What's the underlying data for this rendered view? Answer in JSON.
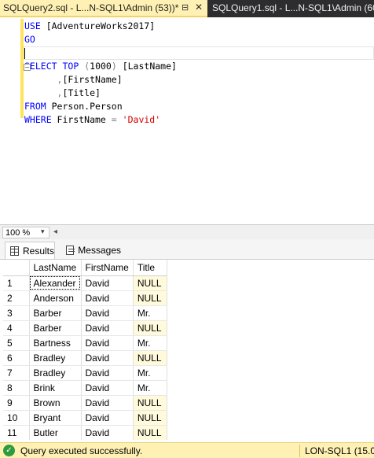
{
  "tabs": {
    "active": {
      "title": "SQLQuery2.sql - L...N-SQL1\\Admin (53))*",
      "pin": "⊟",
      "close": "✕"
    },
    "inactive": {
      "title": "SQLQuery1.sql - L...N-SQL1\\Admin (60"
    }
  },
  "editor": {
    "line1": {
      "kw": "USE",
      "rest": " [AdventureWorks2017]"
    },
    "line2": {
      "kw": "GO"
    },
    "line4": {
      "kw1": "SELECT",
      "sp1": " ",
      "kw2": "TOP",
      "sp2": " ",
      "paren_open": "(",
      "num": "1000",
      "paren_close": ")",
      "rest": " [LastName]"
    },
    "line5": {
      "indent": "      ",
      "comma": ",",
      "col": "[FirstName]"
    },
    "line6": {
      "indent": "      ",
      "comma": ",",
      "col": "[Title]"
    },
    "line7": {
      "kw": "FROM",
      "rest": " Person.Person"
    },
    "line8": {
      "kw": "WHERE",
      "rest": " FirstName ",
      "op": "=",
      "sp": " ",
      "str": "'David'"
    },
    "collapse_glyph": "−"
  },
  "zoom": {
    "value": "100 %",
    "arrow": "▾",
    "scroll_left": "◂"
  },
  "results_tabs": {
    "results": "Results",
    "messages": "Messages"
  },
  "grid": {
    "columns": [
      "LastName",
      "FirstName",
      "Title"
    ],
    "rows": [
      {
        "n": "1",
        "last": "Alexander",
        "first": "David",
        "title": "NULL"
      },
      {
        "n": "2",
        "last": "Anderson",
        "first": "David",
        "title": "NULL"
      },
      {
        "n": "3",
        "last": "Barber",
        "first": "David",
        "title": "Mr."
      },
      {
        "n": "4",
        "last": "Barber",
        "first": "David",
        "title": "NULL"
      },
      {
        "n": "5",
        "last": "Bartness",
        "first": "David",
        "title": "Mr."
      },
      {
        "n": "6",
        "last": "Bradley",
        "first": "David",
        "title": "NULL"
      },
      {
        "n": "7",
        "last": "Bradley",
        "first": "David",
        "title": "Mr."
      },
      {
        "n": "8",
        "last": "Brink",
        "first": "David",
        "title": "Mr."
      },
      {
        "n": "9",
        "last": "Brown",
        "first": "David",
        "title": "NULL"
      },
      {
        "n": "10",
        "last": "Bryant",
        "first": "David",
        "title": "NULL"
      },
      {
        "n": "11",
        "last": "Butler",
        "first": "David",
        "title": "NULL"
      }
    ]
  },
  "status": {
    "icon": "✓",
    "message": "Query executed successfully.",
    "server": "LON-SQL1 (15.0"
  }
}
